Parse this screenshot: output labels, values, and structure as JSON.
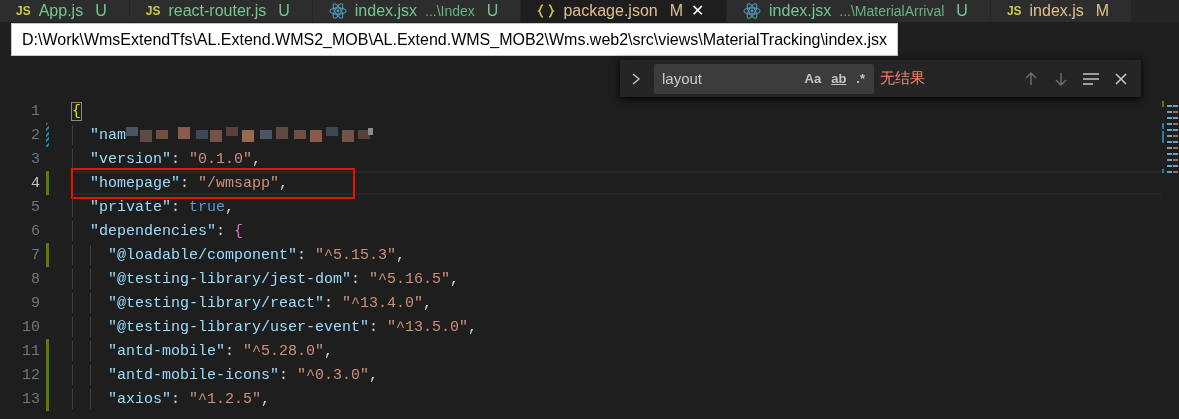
{
  "tabs": [
    {
      "kind": "js",
      "icon_text": "JS",
      "name": "App.js",
      "badge": "U",
      "color": "#73c991",
      "selected": false
    },
    {
      "kind": "js",
      "icon_text": "JS",
      "name": "react-router.js",
      "badge": "U",
      "color": "#73c991",
      "selected": false
    },
    {
      "kind": "react",
      "name": "index.jsx",
      "description": "...\\Index",
      "badge": "U",
      "color": "#73c991",
      "selected": false
    },
    {
      "kind": "json",
      "name": "package.json",
      "badge": "M",
      "color": "#e2c08d",
      "close": "✕",
      "selected": true
    },
    {
      "kind": "react",
      "name": "index.jsx",
      "description": "...\\MaterialArrival",
      "badge": "U",
      "color": "#73c991",
      "selected": false
    },
    {
      "kind": "js",
      "icon_text": "JS",
      "name": "index.js",
      "badge": "M",
      "color": "#e2c08d",
      "selected": false
    }
  ],
  "tooltip": {
    "text": "D:\\Work\\WmsExtendTfs\\AL.Extend.WMS2_MOB\\AL.Extend.WMS_MOB2\\Wms.web2\\src\\views\\MaterialTracking\\index.jsx"
  },
  "find_widget": {
    "value": "layout",
    "options": [
      {
        "label": "Aa",
        "kind": "case",
        "selected": false
      },
      {
        "label": "ab",
        "kind": "word",
        "selected": false
      },
      {
        "label": ".*",
        "kind": "regex",
        "selected": false
      }
    ],
    "result": "无结果"
  },
  "editor": {
    "lines": [
      {
        "number": "1",
        "added": false,
        "modified": false,
        "current": false,
        "boxed": false,
        "tokens": [
          {
            "kind": "bracket-1",
            "text": "{",
            "matched": true
          }
        ],
        "children": [
          {
            "number": "2",
            "added": false,
            "modified": true,
            "current": false,
            "boxed": false,
            "redacted": true,
            "tokens": [
              {
                "kind": "key",
                "text": "\"nam"
              }
            ]
          },
          {
            "number": "3",
            "added": false,
            "modified": false,
            "current": false,
            "boxed": false,
            "tokens": [
              {
                "kind": "key",
                "text": "\"version\""
              },
              {
                "kind": "punct",
                "text": ": "
              },
              {
                "kind": "string",
                "text": "\"0.1.0\""
              },
              {
                "kind": "punct",
                "text": ","
              }
            ]
          },
          {
            "number": "4",
            "added": true,
            "modified": false,
            "current": true,
            "boxed": true,
            "tokens": [
              {
                "kind": "key",
                "text": "\"homepage\""
              },
              {
                "kind": "punct",
                "text": ": "
              },
              {
                "kind": "string",
                "text": "\"/wmsapp\""
              },
              {
                "kind": "punct",
                "text": ","
              }
            ]
          },
          {
            "number": "5",
            "added": false,
            "modified": false,
            "current": false,
            "boxed": false,
            "tokens": [
              {
                "kind": "key",
                "text": "\"private\""
              },
              {
                "kind": "punct",
                "text": ": "
              },
              {
                "kind": "bool",
                "text": "true"
              },
              {
                "kind": "punct",
                "text": ","
              }
            ]
          },
          {
            "number": "6",
            "added": false,
            "modified": false,
            "current": false,
            "boxed": false,
            "tokens": [
              {
                "kind": "key",
                "text": "\"dependencies\""
              },
              {
                "kind": "punct",
                "text": ": "
              },
              {
                "kind": "bracket-2",
                "text": "{"
              }
            ],
            "children": [
              {
                "number": "7",
                "added": true,
                "modified": false,
                "current": false,
                "boxed": false,
                "tokens": [
                  {
                    "kind": "key",
                    "text": "\"@loadable/component\""
                  },
                  {
                    "kind": "punct",
                    "text": ": "
                  },
                  {
                    "kind": "string",
                    "text": "\"^5.15.3\""
                  },
                  {
                    "kind": "punct",
                    "text": ","
                  }
                ]
              },
              {
                "number": "8",
                "added": false,
                "modified": false,
                "current": false,
                "boxed": false,
                "tokens": [
                  {
                    "kind": "key",
                    "text": "\"@testing-library/jest-dom\""
                  },
                  {
                    "kind": "punct",
                    "text": ": "
                  },
                  {
                    "kind": "string",
                    "text": "\"^5.16.5\""
                  },
                  {
                    "kind": "punct",
                    "text": ","
                  }
                ]
              },
              {
                "number": "9",
                "added": false,
                "modified": false,
                "current": false,
                "boxed": false,
                "tokens": [
                  {
                    "kind": "key",
                    "text": "\"@testing-library/react\""
                  },
                  {
                    "kind": "punct",
                    "text": ": "
                  },
                  {
                    "kind": "string",
                    "text": "\"^13.4.0\""
                  },
                  {
                    "kind": "punct",
                    "text": ","
                  }
                ]
              },
              {
                "number": "10",
                "added": false,
                "modified": false,
                "current": false,
                "boxed": false,
                "tokens": [
                  {
                    "kind": "key",
                    "text": "\"@testing-library/user-event\""
                  },
                  {
                    "kind": "punct",
                    "text": ": "
                  },
                  {
                    "kind": "string",
                    "text": "\"^13.5.0\""
                  },
                  {
                    "kind": "punct",
                    "text": ","
                  }
                ]
              },
              {
                "number": "11",
                "added": true,
                "modified": false,
                "current": false,
                "boxed": false,
                "tokens": [
                  {
                    "kind": "key",
                    "text": "\"antd-mobile\""
                  },
                  {
                    "kind": "punct",
                    "text": ": "
                  },
                  {
                    "kind": "string",
                    "text": "\"^5.28.0\""
                  },
                  {
                    "kind": "punct",
                    "text": ","
                  }
                ]
              },
              {
                "number": "12",
                "added": true,
                "modified": false,
                "current": false,
                "boxed": false,
                "tokens": [
                  {
                    "kind": "key",
                    "text": "\"antd-mobile-icons\""
                  },
                  {
                    "kind": "punct",
                    "text": ": "
                  },
                  {
                    "kind": "string",
                    "text": "\"^0.3.0\""
                  },
                  {
                    "kind": "punct",
                    "text": ","
                  }
                ]
              },
              {
                "number": "13",
                "added": true,
                "modified": false,
                "current": false,
                "boxed": false,
                "tokens": [
                  {
                    "kind": "key",
                    "text": "\"axios\""
                  },
                  {
                    "kind": "punct",
                    "text": ": "
                  },
                  {
                    "kind": "string",
                    "text": "\"^1.2.5\""
                  },
                  {
                    "kind": "punct",
                    "text": ","
                  }
                ]
              }
            ]
          }
        ]
      }
    ]
  }
}
